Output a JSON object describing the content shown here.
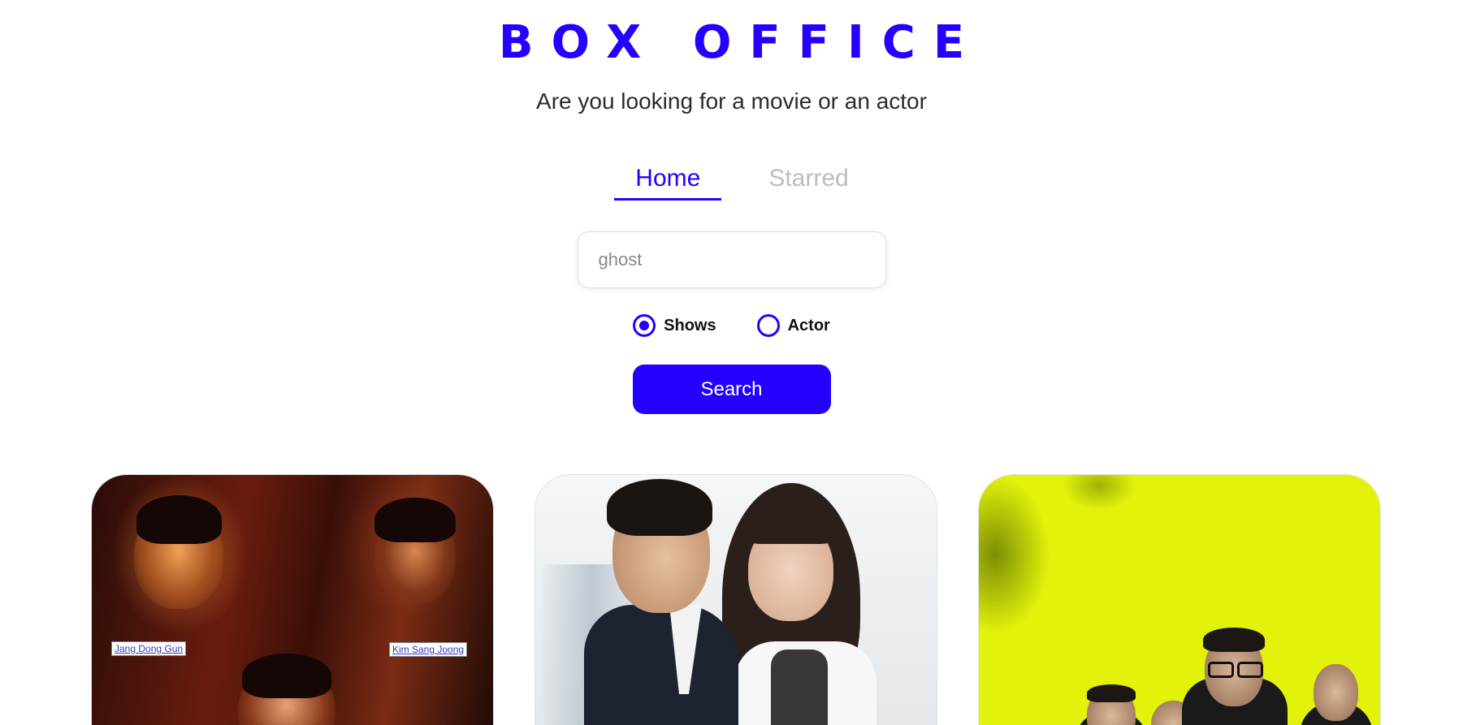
{
  "header": {
    "title": "BOX OFFICE",
    "subtitle": "Are you looking for a movie or an actor"
  },
  "nav": {
    "tabs": [
      {
        "label": "Home",
        "active": true
      },
      {
        "label": "Starred",
        "active": false
      }
    ]
  },
  "search": {
    "value": "",
    "placeholder": "ghost"
  },
  "search_type": {
    "options": [
      {
        "label": "Shows",
        "selected": true
      },
      {
        "label": "Actor",
        "selected": false
      }
    ]
  },
  "search_button": {
    "label": "Search"
  },
  "results": {
    "cards": [
      {
        "poster_tags": [
          "Jang Dong Gun",
          "Kim Sang Joong"
        ]
      },
      {
        "poster_tags": []
      },
      {
        "poster_tags": []
      }
    ]
  },
  "colors": {
    "accent": "#2400ff",
    "inactive_tab": "#bdbdbd",
    "text": "#2b2b2b"
  }
}
